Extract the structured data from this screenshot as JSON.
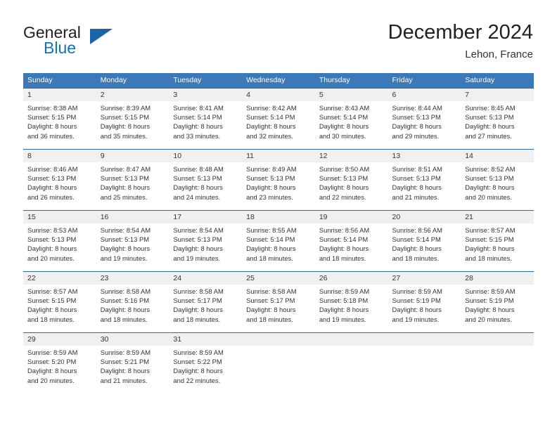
{
  "brand": {
    "name_part1": "General",
    "name_part2": "Blue",
    "triangle_color": "#1b64a8",
    "blue_color": "#1271bb"
  },
  "header": {
    "title": "December 2024",
    "subtitle": "Lehon, France"
  },
  "theme": {
    "header_blue": "#3b79b8",
    "row_border_blue": "#2b6ca8",
    "day_band_gray": "#f0f0f0"
  },
  "weekdays": [
    "Sunday",
    "Monday",
    "Tuesday",
    "Wednesday",
    "Thursday",
    "Friday",
    "Saturday"
  ],
  "weeks": [
    [
      {
        "day": "1",
        "sunrise": "Sunrise: 8:38 AM",
        "sunset": "Sunset: 5:15 PM",
        "daylight1": "Daylight: 8 hours",
        "daylight2": "and 36 minutes."
      },
      {
        "day": "2",
        "sunrise": "Sunrise: 8:39 AM",
        "sunset": "Sunset: 5:15 PM",
        "daylight1": "Daylight: 8 hours",
        "daylight2": "and 35 minutes."
      },
      {
        "day": "3",
        "sunrise": "Sunrise: 8:41 AM",
        "sunset": "Sunset: 5:14 PM",
        "daylight1": "Daylight: 8 hours",
        "daylight2": "and 33 minutes."
      },
      {
        "day": "4",
        "sunrise": "Sunrise: 8:42 AM",
        "sunset": "Sunset: 5:14 PM",
        "daylight1": "Daylight: 8 hours",
        "daylight2": "and 32 minutes."
      },
      {
        "day": "5",
        "sunrise": "Sunrise: 8:43 AM",
        "sunset": "Sunset: 5:14 PM",
        "daylight1": "Daylight: 8 hours",
        "daylight2": "and 30 minutes."
      },
      {
        "day": "6",
        "sunrise": "Sunrise: 8:44 AM",
        "sunset": "Sunset: 5:13 PM",
        "daylight1": "Daylight: 8 hours",
        "daylight2": "and 29 minutes."
      },
      {
        "day": "7",
        "sunrise": "Sunrise: 8:45 AM",
        "sunset": "Sunset: 5:13 PM",
        "daylight1": "Daylight: 8 hours",
        "daylight2": "and 27 minutes."
      }
    ],
    [
      {
        "day": "8",
        "sunrise": "Sunrise: 8:46 AM",
        "sunset": "Sunset: 5:13 PM",
        "daylight1": "Daylight: 8 hours",
        "daylight2": "and 26 minutes."
      },
      {
        "day": "9",
        "sunrise": "Sunrise: 8:47 AM",
        "sunset": "Sunset: 5:13 PM",
        "daylight1": "Daylight: 8 hours",
        "daylight2": "and 25 minutes."
      },
      {
        "day": "10",
        "sunrise": "Sunrise: 8:48 AM",
        "sunset": "Sunset: 5:13 PM",
        "daylight1": "Daylight: 8 hours",
        "daylight2": "and 24 minutes."
      },
      {
        "day": "11",
        "sunrise": "Sunrise: 8:49 AM",
        "sunset": "Sunset: 5:13 PM",
        "daylight1": "Daylight: 8 hours",
        "daylight2": "and 23 minutes."
      },
      {
        "day": "12",
        "sunrise": "Sunrise: 8:50 AM",
        "sunset": "Sunset: 5:13 PM",
        "daylight1": "Daylight: 8 hours",
        "daylight2": "and 22 minutes."
      },
      {
        "day": "13",
        "sunrise": "Sunrise: 8:51 AM",
        "sunset": "Sunset: 5:13 PM",
        "daylight1": "Daylight: 8 hours",
        "daylight2": "and 21 minutes."
      },
      {
        "day": "14",
        "sunrise": "Sunrise: 8:52 AM",
        "sunset": "Sunset: 5:13 PM",
        "daylight1": "Daylight: 8 hours",
        "daylight2": "and 20 minutes."
      }
    ],
    [
      {
        "day": "15",
        "sunrise": "Sunrise: 8:53 AM",
        "sunset": "Sunset: 5:13 PM",
        "daylight1": "Daylight: 8 hours",
        "daylight2": "and 20 minutes."
      },
      {
        "day": "16",
        "sunrise": "Sunrise: 8:54 AM",
        "sunset": "Sunset: 5:13 PM",
        "daylight1": "Daylight: 8 hours",
        "daylight2": "and 19 minutes."
      },
      {
        "day": "17",
        "sunrise": "Sunrise: 8:54 AM",
        "sunset": "Sunset: 5:13 PM",
        "daylight1": "Daylight: 8 hours",
        "daylight2": "and 19 minutes."
      },
      {
        "day": "18",
        "sunrise": "Sunrise: 8:55 AM",
        "sunset": "Sunset: 5:14 PM",
        "daylight1": "Daylight: 8 hours",
        "daylight2": "and 18 minutes."
      },
      {
        "day": "19",
        "sunrise": "Sunrise: 8:56 AM",
        "sunset": "Sunset: 5:14 PM",
        "daylight1": "Daylight: 8 hours",
        "daylight2": "and 18 minutes."
      },
      {
        "day": "20",
        "sunrise": "Sunrise: 8:56 AM",
        "sunset": "Sunset: 5:14 PM",
        "daylight1": "Daylight: 8 hours",
        "daylight2": "and 18 minutes."
      },
      {
        "day": "21",
        "sunrise": "Sunrise: 8:57 AM",
        "sunset": "Sunset: 5:15 PM",
        "daylight1": "Daylight: 8 hours",
        "daylight2": "and 18 minutes."
      }
    ],
    [
      {
        "day": "22",
        "sunrise": "Sunrise: 8:57 AM",
        "sunset": "Sunset: 5:15 PM",
        "daylight1": "Daylight: 8 hours",
        "daylight2": "and 18 minutes."
      },
      {
        "day": "23",
        "sunrise": "Sunrise: 8:58 AM",
        "sunset": "Sunset: 5:16 PM",
        "daylight1": "Daylight: 8 hours",
        "daylight2": "and 18 minutes."
      },
      {
        "day": "24",
        "sunrise": "Sunrise: 8:58 AM",
        "sunset": "Sunset: 5:17 PM",
        "daylight1": "Daylight: 8 hours",
        "daylight2": "and 18 minutes."
      },
      {
        "day": "25",
        "sunrise": "Sunrise: 8:58 AM",
        "sunset": "Sunset: 5:17 PM",
        "daylight1": "Daylight: 8 hours",
        "daylight2": "and 18 minutes."
      },
      {
        "day": "26",
        "sunrise": "Sunrise: 8:59 AM",
        "sunset": "Sunset: 5:18 PM",
        "daylight1": "Daylight: 8 hours",
        "daylight2": "and 19 minutes."
      },
      {
        "day": "27",
        "sunrise": "Sunrise: 8:59 AM",
        "sunset": "Sunset: 5:19 PM",
        "daylight1": "Daylight: 8 hours",
        "daylight2": "and 19 minutes."
      },
      {
        "day": "28",
        "sunrise": "Sunrise: 8:59 AM",
        "sunset": "Sunset: 5:19 PM",
        "daylight1": "Daylight: 8 hours",
        "daylight2": "and 20 minutes."
      }
    ],
    [
      {
        "day": "29",
        "sunrise": "Sunrise: 8:59 AM",
        "sunset": "Sunset: 5:20 PM",
        "daylight1": "Daylight: 8 hours",
        "daylight2": "and 20 minutes."
      },
      {
        "day": "30",
        "sunrise": "Sunrise: 8:59 AM",
        "sunset": "Sunset: 5:21 PM",
        "daylight1": "Daylight: 8 hours",
        "daylight2": "and 21 minutes."
      },
      {
        "day": "31",
        "sunrise": "Sunrise: 8:59 AM",
        "sunset": "Sunset: 5:22 PM",
        "daylight1": "Daylight: 8 hours",
        "daylight2": "and 22 minutes."
      },
      {
        "day": "",
        "sunrise": "",
        "sunset": "",
        "daylight1": "",
        "daylight2": ""
      },
      {
        "day": "",
        "sunrise": "",
        "sunset": "",
        "daylight1": "",
        "daylight2": ""
      },
      {
        "day": "",
        "sunrise": "",
        "sunset": "",
        "daylight1": "",
        "daylight2": ""
      },
      {
        "day": "",
        "sunrise": "",
        "sunset": "",
        "daylight1": "",
        "daylight2": ""
      }
    ]
  ]
}
